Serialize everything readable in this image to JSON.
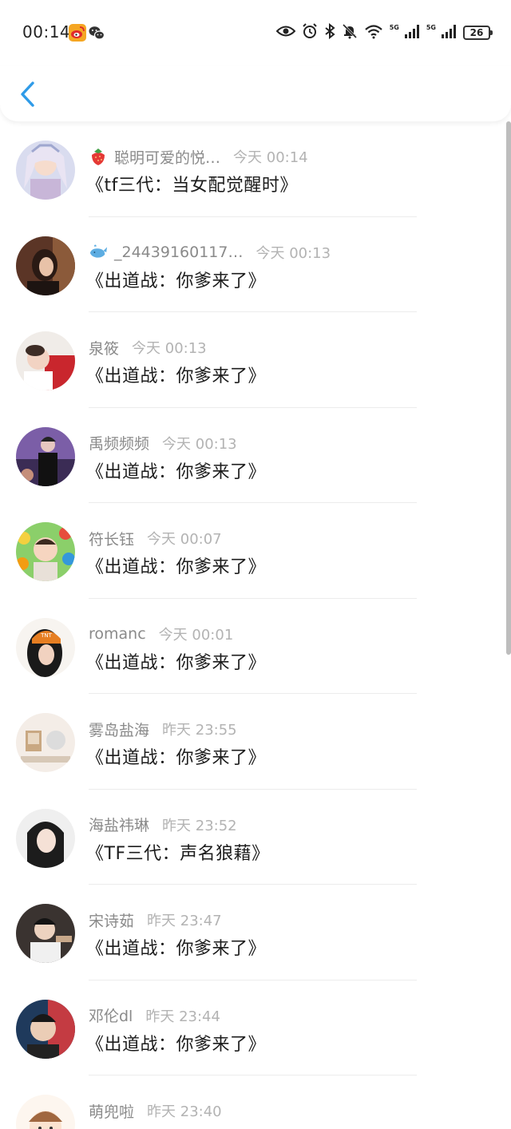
{
  "status_bar": {
    "time": "00:14",
    "network_1": "5G",
    "network_2": "5G",
    "battery": "26",
    "icons": [
      "weibo-icon",
      "wechat-icon",
      "eye-icon",
      "alarm-icon",
      "bluetooth-icon",
      "mute-bell-icon",
      "wifi-icon",
      "signal-icon",
      "signal-icon",
      "battery-icon"
    ]
  },
  "header": {
    "back_icon": "chevron-left-icon",
    "accent": "#2f9be8"
  },
  "colors": {
    "name": "#8a8a8a",
    "time": "#b3b3b3",
    "title": "#1c1c1c",
    "divider": "#ececec"
  },
  "rows": [
    {
      "emoji": "strawberry",
      "name": "聪明可爱的悦…",
      "time": "今天 00:14",
      "title": "《tf三代：当女配觉醒时》",
      "avatar": "avatar-1"
    },
    {
      "emoji": "whale",
      "name": "_24439160117…",
      "time": "今天 00:13",
      "title": "《出道战：你爹来了》",
      "avatar": "avatar-2"
    },
    {
      "name": "泉筱",
      "time": "今天 00:13",
      "title": "《出道战：你爹来了》",
      "avatar": "avatar-3"
    },
    {
      "name": "禹频频频",
      "time": "今天 00:13",
      "title": "《出道战：你爹来了》",
      "avatar": "avatar-4"
    },
    {
      "name": "符长钰",
      "time": "今天 00:07",
      "title": "《出道战：你爹来了》",
      "avatar": "avatar-5"
    },
    {
      "name": "romanc",
      "time": "今天 00:01",
      "title": "《出道战：你爹来了》",
      "avatar": "avatar-6"
    },
    {
      "name": "雾岛盐海",
      "time": "昨天 23:55",
      "title": "《出道战：你爹来了》",
      "avatar": "avatar-7"
    },
    {
      "name": "海盐祎琳",
      "time": "昨天 23:52",
      "title": "《TF三代：声名狼藉》",
      "avatar": "avatar-8"
    },
    {
      "name": "宋诗茹",
      "time": "昨天 23:47",
      "title": "《出道战：你爹来了》",
      "avatar": "avatar-9"
    },
    {
      "name": "邓伦dl",
      "time": "昨天 23:44",
      "title": "《出道战：你爹来了》",
      "avatar": "avatar-10"
    },
    {
      "name": "萌兜啦",
      "time": "昨天 23:40",
      "title": "",
      "avatar": "avatar-11"
    }
  ]
}
